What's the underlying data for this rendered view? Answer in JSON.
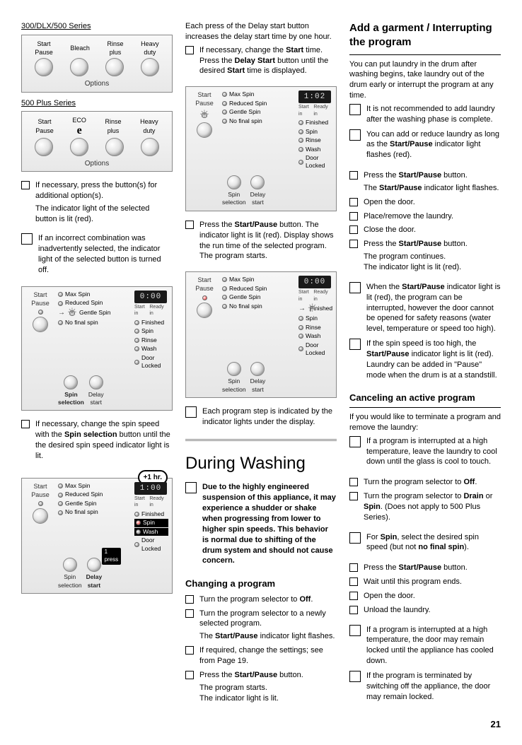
{
  "col1": {
    "series300": "300/DLX/500 Series",
    "panel1": {
      "labels": [
        "Start\nPause",
        "Bleach",
        "Rinse\nplus",
        "Heavy\nduty"
      ],
      "options": "Options"
    },
    "series500": "500 Plus Series",
    "panel2": {
      "labels": [
        "Start\nPause",
        "ECO",
        "Rinse\nplus",
        "Heavy\nduty"
      ],
      "options": "Options",
      "eco": "e"
    },
    "step1": "If necessary, press the button(s) for additional option(s).",
    "step1b": "The indicator light of the selected button is lit (red).",
    "note1": "If an incorrect combination was inadvertently selected, the indicator light of the selected button is turned off.",
    "cp1": {
      "start": "Start\nPause",
      "spins": [
        "Max Spin",
        "Reduced Spin",
        "Gentle Spin",
        "No final spin"
      ],
      "disp": "0:00",
      "startin": "Start in",
      "readyin": "Ready in",
      "status": [
        "Finished",
        "Spin",
        "Rinse",
        "Wash",
        "Door Locked"
      ],
      "spinbtn": "Spin\nselection",
      "delaybtn": "Delay\nstart"
    },
    "step2": "If necessary, change the spin speed with the Spin selection button until the the desired spin speed indicator light is lit.",
    "bubble": "+1 hr.",
    "pressflag": "1 press",
    "cp2": {
      "disp": "1:00"
    }
  },
  "col2": {
    "intro": "Each press of the Delay start button increases the delay start time by one hour.",
    "step1a": "If necessary, change the ",
    "step1b": "Start",
    "step1c": " time. Press the ",
    "step1d": "Delay Start",
    "step1e": " button until the desired ",
    "step1f": "Start",
    "step1g": " time is displayed.",
    "cp1disp": "1:02",
    "step2a": "Press the ",
    "step2b": "Start/Pause",
    "step2c": " button. The indicator light is lit (red). Display shows the run time of the selected program. The program starts.",
    "cp2disp": "0:00",
    "note1": "Each program step is indicated by the indicator lights under the display.",
    "h1": "During Washing",
    "warn": "Due to the highly engineered suspension of this appliance, it may experience a shudder or shake when progressing from lower to higher spin speeds. This behavior is normal due to shifting of the drum system and should not cause concern.",
    "h3": "Changing a program",
    "c1": "Turn the program selector to Off.",
    "c2": "Turn the program selector to a newly selected program.",
    "c2b": "The Start/Pause indicator light flashes.",
    "c3": "If required, change the settings; see from Page  19.",
    "c4a": "Press the ",
    "c4b": "Start/Pause",
    "c4c": " button.",
    "c4d": "The program starts.",
    "c4e": "The indicator light is lit."
  },
  "col3": {
    "h2": "Add a garment / Interrupting the program",
    "intro": "You can put laundry in the drum after washing begins, take laundry out of the drum early or interrupt the program at any time.",
    "n1": "It is not recommended to add laundry after the washing phase is complete.",
    "n2a": "You can add or reduce laundry as long as the ",
    "n2b": "Start/Pause",
    "n2c": " indicator light flashes (red).",
    "s1a": "Press the ",
    "s1b": "Start/Pause",
    "s1c": " button.",
    "s1d": "The Start/Pause indicator light flashes.",
    "s2": "Open the door.",
    "s3": "Place/remove the laundry.",
    "s4": "Close the door.",
    "s5a": "Press the ",
    "s5b": "Start/Pause",
    "s5c": " button.",
    "s5d": "The program continues.",
    "s5e": "The indicator light is lit (red).",
    "n3a": "When the ",
    "n3b": "Start/Pause",
    "n3c": " indicator light is lit (red), the program can be interrupted, however the door cannot be opened for safety reasons (water level, temperature or speed too high).",
    "n4a": "If the spin speed is too high, the ",
    "n4b": "Start/Pause",
    "n4c": " indicator light is lit (red). Laundry can be added in \"Pause\" mode when the drum is at a standstill.",
    "h3": "Canceling an active program",
    "intro2": "If you would like to terminate a program and remove the laundry:",
    "c1": "If a program is interrupted at a high temperature, leave the laundry to cool down until the glass is cool to touch.",
    "c2a": "Turn the program selector to ",
    "c2b": "Off",
    "c2c": ".",
    "c3a": "Turn the program selector to ",
    "c3b": "Drain",
    "c3c": " or ",
    "c3d": "Spin",
    "c3e": ".  (Does not apply to 500 Plus Series).",
    "c4a": "For ",
    "c4b": "Spin",
    "c4c": ", select the desired spin speed (but not ",
    "c4d": "no final spin",
    "c4e": ").",
    "c5a": "Press the ",
    "c5b": "Start/Pause",
    "c5c": " button.",
    "c6": "Wait until this program ends.",
    "c7": "Open the door.",
    "c8": "Unload the laundry.",
    "c9": "If a program is interrupted at a high temperature, the door may remain locked until the appliance has cooled down.",
    "c10": "If the program is terminated by switching off the appliance, the door may remain locked."
  },
  "pagenum": "21"
}
